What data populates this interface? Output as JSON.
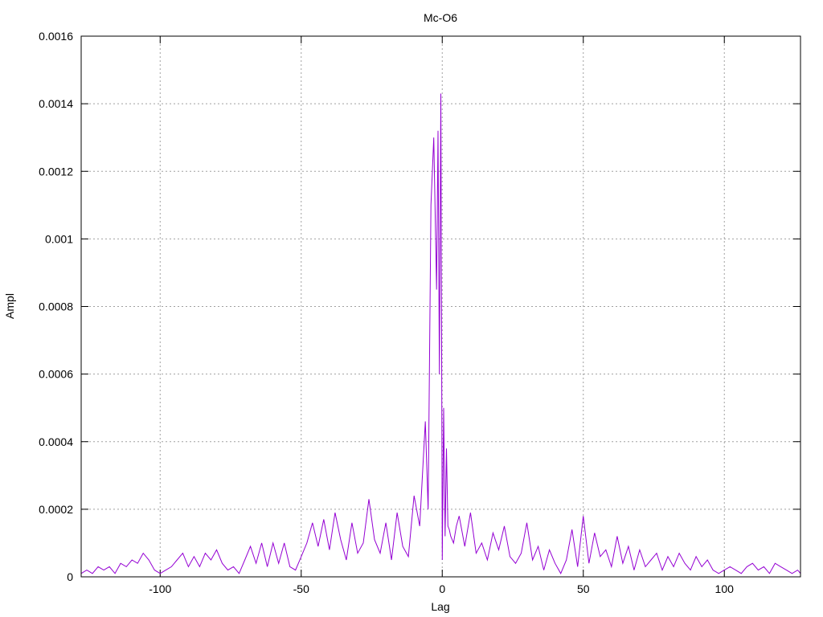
{
  "chart_data": {
    "type": "line",
    "title": "Mc-O6",
    "xlabel": "Lag",
    "ylabel": "Ampl",
    "xlim": [
      -128,
      127
    ],
    "ylim": [
      0,
      0.0016
    ],
    "x_ticks": [
      -100,
      -50,
      0,
      50,
      100
    ],
    "x_tick_labels": [
      "-100",
      "-50",
      "0",
      "50",
      "100"
    ],
    "y_ticks": [
      0,
      0.0002,
      0.0004,
      0.0006,
      0.0008,
      0.001,
      0.0012,
      0.0014,
      0.0016
    ],
    "y_tick_labels": [
      "0",
      "0.0002",
      "0.0004",
      "0.0006",
      "0.0008",
      "0.001",
      "0.0012",
      "0.0014",
      "0.0016"
    ],
    "grid": true,
    "line_color": "#9400d3",
    "series": [
      {
        "x": [
          -128,
          -126,
          -124,
          -122,
          -120,
          -118,
          -116,
          -114,
          -112,
          -110,
          -108,
          -106,
          -104,
          -102,
          -100,
          -98,
          -96,
          -94,
          -92,
          -90,
          -88,
          -86,
          -84,
          -82,
          -80,
          -78,
          -76,
          -74,
          -72,
          -70,
          -68,
          -66,
          -64,
          -62,
          -60,
          -58,
          -56,
          -54,
          -52,
          -50,
          -48,
          -46,
          -44,
          -42,
          -40,
          -38,
          -36,
          -34,
          -32,
          -30,
          -28,
          -26,
          -24,
          -22,
          -20,
          -18,
          -16,
          -14,
          -12,
          -10,
          -8,
          -6,
          -5,
          -4,
          -3,
          -2,
          -1.5,
          -1,
          -0.5,
          0,
          0.5,
          1,
          1.5,
          2,
          2.5,
          3,
          4,
          5,
          6,
          8,
          10,
          12,
          14,
          16,
          18,
          20,
          22,
          24,
          26,
          28,
          30,
          32,
          34,
          36,
          38,
          40,
          42,
          44,
          46,
          48,
          50,
          52,
          54,
          56,
          58,
          60,
          62,
          64,
          66,
          68,
          70,
          72,
          74,
          76,
          78,
          80,
          82,
          84,
          86,
          88,
          90,
          92,
          94,
          96,
          98,
          100,
          102,
          104,
          106,
          108,
          110,
          112,
          114,
          116,
          118,
          120,
          122,
          124,
          126,
          127
        ],
        "y": [
          1e-05,
          2e-05,
          1e-05,
          3e-05,
          2e-05,
          3e-05,
          1e-05,
          4e-05,
          3e-05,
          5e-05,
          4e-05,
          7e-05,
          5e-05,
          2e-05,
          1e-05,
          2e-05,
          3e-05,
          5e-05,
          7e-05,
          3e-05,
          6e-05,
          3e-05,
          7e-05,
          5e-05,
          8e-05,
          4e-05,
          2e-05,
          3e-05,
          1e-05,
          5e-05,
          9e-05,
          4e-05,
          0.0001,
          3e-05,
          0.0001,
          4e-05,
          0.0001,
          3e-05,
          2e-05,
          6e-05,
          0.0001,
          0.00016,
          9e-05,
          0.00017,
          8e-05,
          0.00019,
          0.00011,
          5e-05,
          0.00016,
          7e-05,
          0.0001,
          0.00023,
          0.00011,
          7e-05,
          0.00016,
          5e-05,
          0.00019,
          9e-05,
          6e-05,
          0.00024,
          0.00015,
          0.00046,
          0.0002,
          0.0011,
          0.0013,
          0.00085,
          0.00132,
          0.0006,
          0.00143,
          5e-05,
          0.0005,
          0.00012,
          0.00038,
          0.00015,
          0.00014,
          0.00012,
          0.0001,
          0.00015,
          0.00018,
          9e-05,
          0.00019,
          7e-05,
          0.0001,
          5e-05,
          0.00013,
          8e-05,
          0.00015,
          6e-05,
          4e-05,
          7e-05,
          0.00016,
          5e-05,
          9e-05,
          2e-05,
          8e-05,
          4e-05,
          1e-05,
          5e-05,
          0.00014,
          3e-05,
          0.00018,
          4e-05,
          0.00013,
          6e-05,
          8e-05,
          3e-05,
          0.00012,
          4e-05,
          9e-05,
          2e-05,
          8e-05,
          3e-05,
          5e-05,
          7e-05,
          2e-05,
          6e-05,
          3e-05,
          7e-05,
          4e-05,
          2e-05,
          6e-05,
          3e-05,
          5e-05,
          2e-05,
          1e-05,
          2e-05,
          3e-05,
          2e-05,
          1e-05,
          3e-05,
          4e-05,
          2e-05,
          3e-05,
          1e-05,
          4e-05,
          3e-05,
          2e-05,
          1e-05,
          2e-05,
          1e-05
        ]
      }
    ]
  }
}
